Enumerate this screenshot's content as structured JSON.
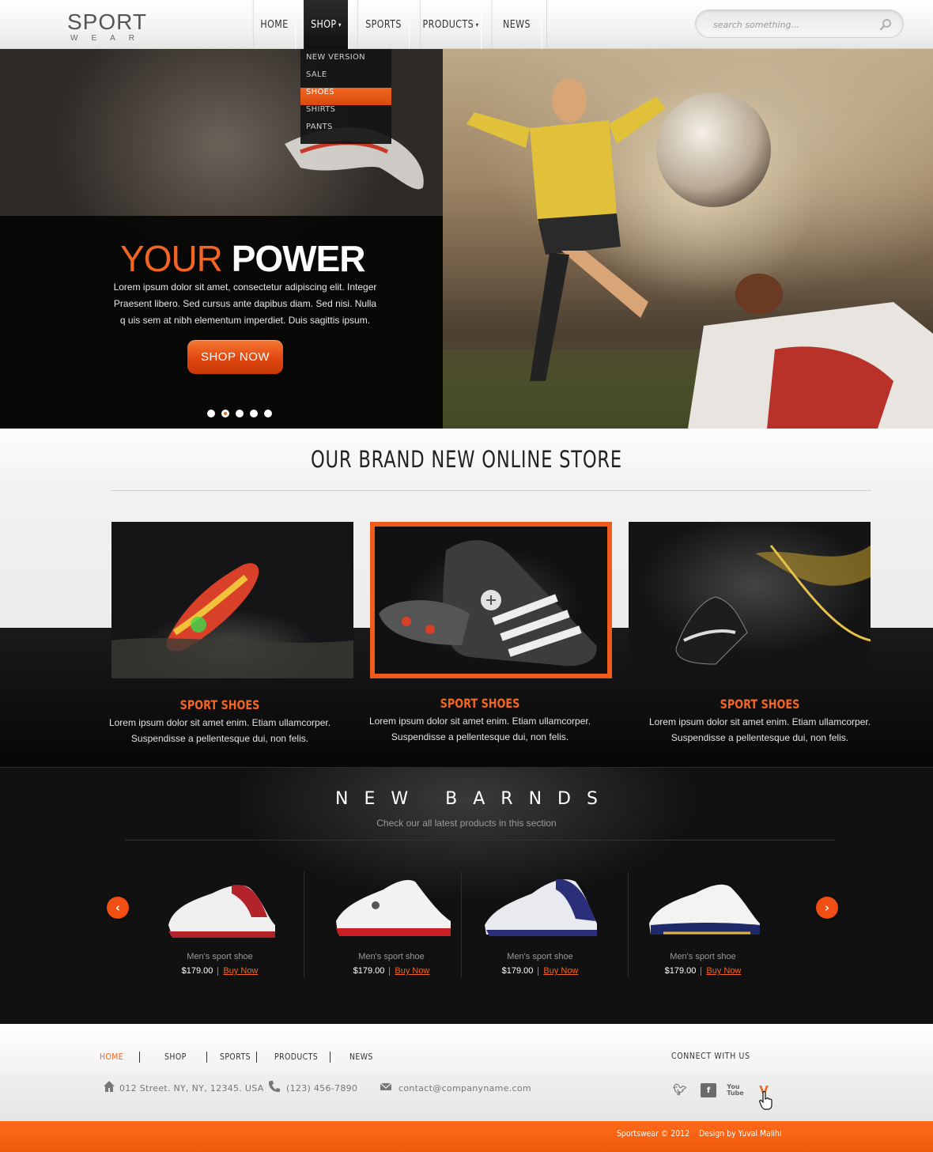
{
  "logo": {
    "main": "SPORT",
    "sub": "WEAR"
  },
  "nav": [
    {
      "label": "HOME",
      "has_caret": false
    },
    {
      "label": "SHOP",
      "has_caret": true,
      "active": true
    },
    {
      "label": "SPORTS",
      "has_caret": false
    },
    {
      "label": "PRODUCTS",
      "has_caret": true
    },
    {
      "label": "NEWS",
      "has_caret": false
    }
  ],
  "search": {
    "placeholder": "search something..."
  },
  "dropdown": {
    "items": [
      "NEW VERSION",
      "SALE",
      "SHOES",
      "SHIRTS",
      "PANTS"
    ],
    "selected": "SHOES"
  },
  "hero": {
    "title_part1": "YOUR",
    "title_part2": "POWER",
    "text": "Lorem ipsum dolor sit amet, consectetur adipiscing elit. Integer Praesent libero. Sed cursus ante dapibus diam. Sed nisi. Nulla q uis sem at nibh elementum imperdiet. Duis sagittis ipsum.",
    "button": "SHOP NOW",
    "slide_count": 5,
    "active_slide": 2
  },
  "store": {
    "title": "OUR BRAND NEW ONLINE STORE",
    "cards": [
      {
        "title": "SPORT SHOES",
        "text_line1": "Lorem ipsum dolor sit amet enim. Etiam ullamcorper.",
        "text_line2": "Suspendisse a pellentesque dui, non felis."
      },
      {
        "title": "SPORT SHOES",
        "text_line1": "Lorem ipsum dolor sit amet enim. Etiam ullamcorper.",
        "text_line2": "Suspendisse a pellentesque dui, non felis."
      },
      {
        "title": "SPORT SHOES",
        "text_line1": "Lorem ipsum dolor sit amet enim. Etiam ullamcorper.",
        "text_line2": "Suspendisse a pellentesque dui, non felis."
      }
    ]
  },
  "brands": {
    "title": "NEW BARNDS",
    "subtitle": "Check our all latest products in this section",
    "products": [
      {
        "name": "Men's sport shoe",
        "price": "$179.00",
        "buy": "Buy Now",
        "accent": "#b3232a"
      },
      {
        "name": "Men's sport shoe",
        "price": "$179.00",
        "buy": "Buy Now",
        "accent": "#c81f24"
      },
      {
        "name": "Men's sport shoe",
        "price": "$179.00",
        "buy": "Buy Now",
        "accent": "#2b2f7a"
      },
      {
        "name": "Men's sport shoe",
        "price": "$179.00",
        "buy": "Buy Now",
        "accent": "#1f2a6b"
      }
    ]
  },
  "footer": {
    "nav": [
      "HOME",
      "SHOP",
      "SPORTS",
      "PRODUCTS",
      "NEWS"
    ],
    "connect": "CONNECT WITH US",
    "address": "012 Street. NY, NY, 12345. USA",
    "phone": "(123) 456-7890",
    "email": "contact@companyname.com",
    "social": [
      "twitter-icon",
      "facebook-icon",
      "youtube-icon",
      "vimeo-icon"
    ],
    "copyright": "Sportswear © 2012",
    "credit": "Design by Yuval Malihi"
  },
  "colors": {
    "accent": "#f26522",
    "dark": "#0b0b0b"
  }
}
